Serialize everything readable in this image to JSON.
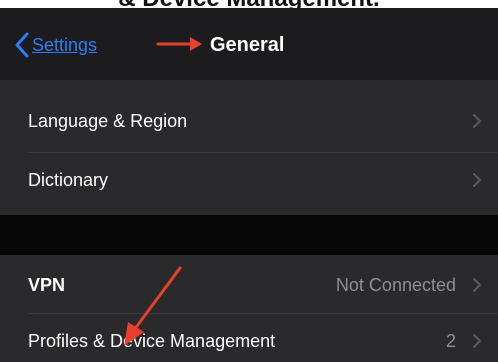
{
  "caption": "& Device Management.",
  "navbar": {
    "back_label": "Settings",
    "title": "General"
  },
  "sections": [
    {
      "rows": [
        {
          "label": "Language & Region",
          "value": ""
        },
        {
          "label": "Dictionary",
          "value": ""
        }
      ]
    },
    {
      "rows": [
        {
          "label": "VPN",
          "value": "Not Connected"
        },
        {
          "label": "Profiles & Device Management",
          "value": "2"
        }
      ]
    }
  ],
  "colors": {
    "accent": "#2f7df6",
    "annotation": "#e8402a",
    "background": "#1c1c1e",
    "cell": "#2a2a2c",
    "secondary_text": "#8e8e93"
  },
  "icons": {
    "back": "chevron-left-icon",
    "disclosure": "chevron-right-icon",
    "annotation": "red-arrow-icon"
  }
}
